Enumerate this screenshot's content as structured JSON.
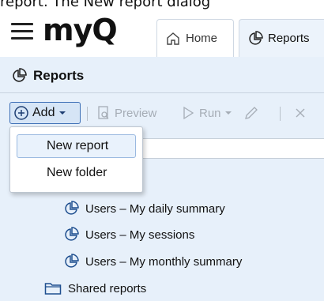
{
  "caption": "report. The New report dialog",
  "header": {
    "logo": "myQ",
    "tabs": [
      {
        "label": "Home",
        "icon": "home-icon"
      },
      {
        "label": "Reports",
        "icon": "reports-icon"
      }
    ]
  },
  "panel": {
    "title": "Reports"
  },
  "toolbar": {
    "add_label": "Add",
    "preview_label": "Preview",
    "run_label": "Run"
  },
  "dropdown": {
    "items": [
      {
        "label": "New report",
        "highlighted": true
      },
      {
        "label": "New folder",
        "highlighted": false
      }
    ]
  },
  "tree": {
    "items": [
      {
        "label": "Users – My daily summary",
        "icon": "report-icon"
      },
      {
        "label": "Users – My sessions",
        "icon": "report-icon"
      },
      {
        "label": "Users – My monthly summary",
        "icon": "report-icon"
      },
      {
        "label": "Shared reports",
        "icon": "folder-icon"
      }
    ]
  },
  "colors": {
    "panel_bg": "#e7f0fa",
    "accent": "#3d6fb6",
    "disabled": "#a6adb6"
  }
}
